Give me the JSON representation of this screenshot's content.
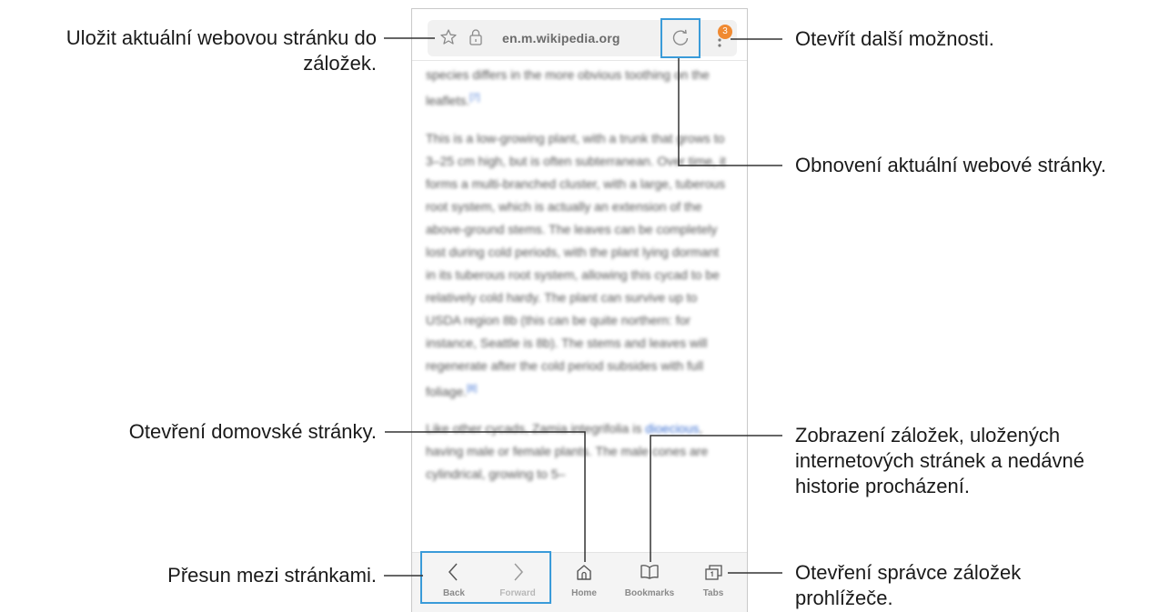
{
  "browser": {
    "url": "en.m.wikipedia.org",
    "tabs_badge": "3",
    "accent_color": "#3a9bd9",
    "badge_color": "#f08a32",
    "icons": [
      "star-icon",
      "lock-icon",
      "reload-icon",
      "more-options-icon",
      "back-icon",
      "forward-icon",
      "home-icon",
      "bookmarks-icon",
      "tabs-icon"
    ]
  },
  "article": {
    "p1": "species differs in the more obvious toothing on the leaflets.",
    "p1_ref": "[7]",
    "p2": "This is a low-growing plant, with a trunk that grows to 3–25 cm high, but is often subterranean. Over time, it forms a multi-branched cluster, with a large, tuberous root system, which is actually an extension of the above-ground stems. The leaves can be completely lost during cold periods, with the plant lying dormant in its tuberous root system, allowing this cycad to be relatively cold hardy. The plant can survive up to USDA region 8b (this can be quite northern: for instance, Seattle is 8b). The stems and leaves will regenerate after the cold period subsides with full foliage.",
    "p2_ref": "[8]",
    "p3_a": "Like other cycads, Zamia integrifolia is",
    "p3_link": "dioecious",
    "p3_b": ", having male or female plants. The male cones are cylindrical, growing to 5–"
  },
  "toolbar": {
    "back": "Back",
    "forward": "Forward",
    "home": "Home",
    "bookmarks": "Bookmarks",
    "tabs": "Tabs"
  },
  "callouts": {
    "bookmark_save": "Uložit aktuální webovou stránku do záložek.",
    "more_options": "Otevřít další možnosti.",
    "refresh": "Obnovení aktuální webové stránky.",
    "home": "Otevření domovské stránky.",
    "bookmarks": "Zobrazení záložek, uložených internetových stránek a nedávné historie procházení.",
    "navigate": "Přesun mezi stránkami.",
    "tabs": "Otevření správce záložek prohlížeče."
  }
}
